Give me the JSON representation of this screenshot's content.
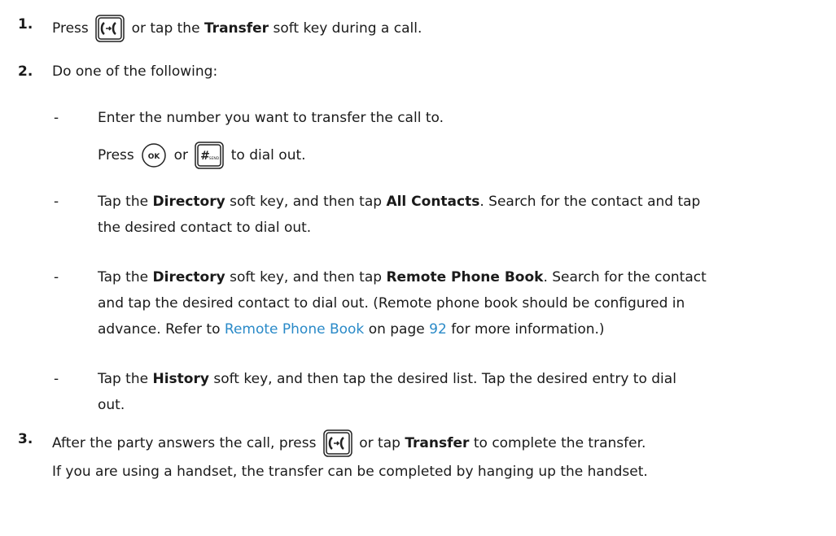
{
  "steps": [
    {
      "num": "1.",
      "p1": "Press",
      "p2": "or tap the",
      "b1": "Transfer",
      "p3": "soft key during a call.",
      "key_icon": "transfer-key-icon"
    },
    {
      "num": "2.",
      "text": "Do one of the following:",
      "options": [
        {
          "dash": "-",
          "line1": "Enter the number you want to transfer the call to.",
          "line2_a": "Press",
          "line2_b": "or",
          "line2_c": "to dial out.",
          "ok_label": "OK",
          "send_hash": "#",
          "send_label": "SEND"
        },
        {
          "dash": "-",
          "a": "Tap the",
          "b1": "Directory",
          "c": "soft key, and then tap",
          "b2": "All Contacts",
          "d": ". Search for the contact and tap",
          "line2": "the desired contact to dial out."
        },
        {
          "dash": "-",
          "a": "Tap the",
          "b1": "Directory",
          "c": "soft key, and then tap",
          "b2": "Remote Phone Book",
          "d": ". Search for the contact",
          "line2": "and tap the desired contact to dial out. (Remote phone book should be configured in",
          "line3_a": "advance. Refer to",
          "line3_link": "Remote Phone Book",
          "line3_b": "on page",
          "line3_page": "92",
          "line3_c": "for more information.)"
        },
        {
          "dash": "-",
          "a": "Tap the",
          "b1": "History",
          "c": "soft key, and then tap the desired list. Tap the desired entry to dial",
          "line2": "out."
        }
      ]
    },
    {
      "num": "3.",
      "a": "After the party answers the call, press",
      "b": "or tap",
      "b1": "Transfer",
      "c": "to complete the transfer.",
      "line2": "If you are using a handset, the transfer can be completed by hanging up the handset."
    }
  ]
}
